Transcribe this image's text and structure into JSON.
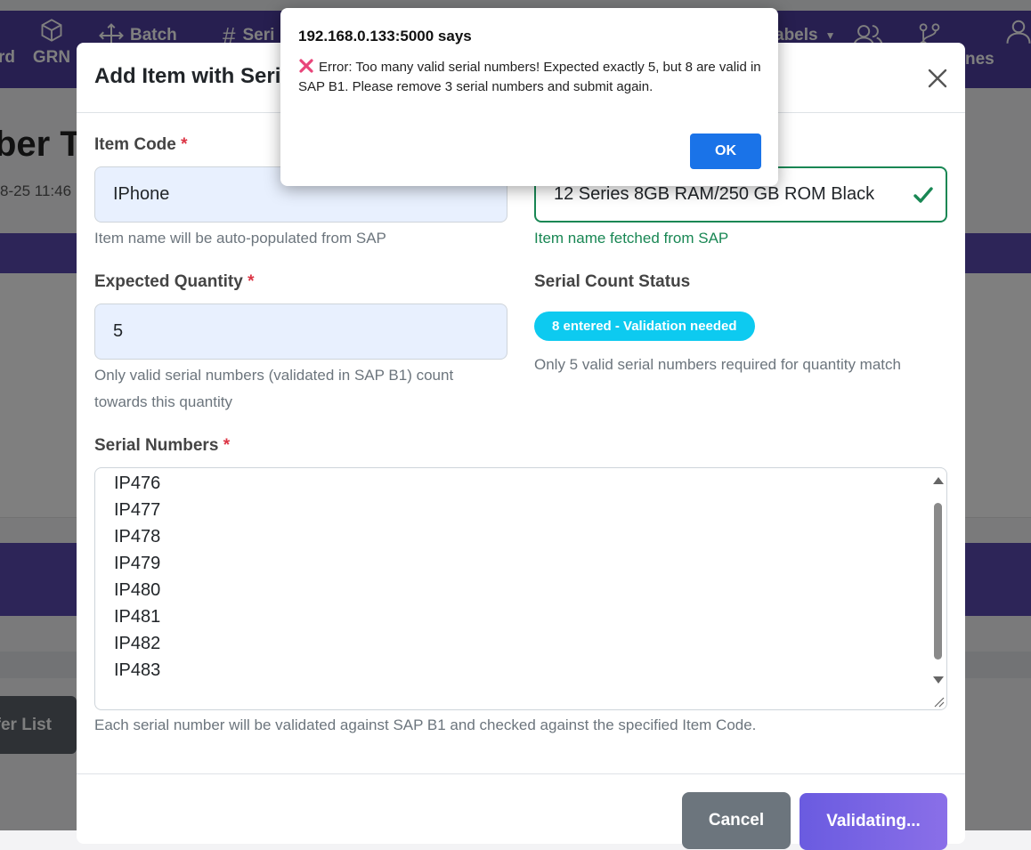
{
  "navbar": {
    "items": [
      {
        "label": "rd",
        "icon": "dashboard-icon"
      },
      {
        "label": "GRN",
        "icon": "box-icon"
      },
      {
        "label": "Batch",
        "icon": "move-icon"
      },
      {
        "label": "Seri",
        "icon": "hash-icon"
      },
      {
        "label": "abels",
        "icon": "label-icon"
      },
      {
        "label": "",
        "icon": "users-icon"
      },
      {
        "label": "",
        "icon": "branch-icon"
      },
      {
        "label": "nes",
        "icon": "user-icon"
      }
    ]
  },
  "background": {
    "page_title": "ber Tr",
    "date_text": "8-25 11:46",
    "back_button": "fer List"
  },
  "modal": {
    "title": "Add Item with Seri",
    "item_code": {
      "label": "Item Code",
      "required_mark": "*",
      "value": "IPhone",
      "help": "Item name will be auto-populated from SAP"
    },
    "item_name": {
      "value": "12 Series 8GB RAM/250 GB ROM Black",
      "help": "Item name fetched from SAP"
    },
    "expected_quantity": {
      "label": "Expected Quantity",
      "required_mark": "*",
      "value": "5",
      "help_line1": "Only valid serial numbers (validated in SAP B1) count",
      "help_line2": "towards this quantity"
    },
    "serial_status": {
      "label": "Serial Count Status",
      "badge": "8 entered - Validation needed",
      "help": "Only 5 valid serial numbers required for quantity match"
    },
    "serial_numbers": {
      "label": "Serial Numbers",
      "required_mark": "*",
      "values": [
        "IP476",
        "IP477",
        "IP478",
        "IP479",
        "IP480",
        "IP481",
        "IP482",
        "IP483"
      ],
      "help": "Each serial number will be validated against SAP B1 and checked against the specified Item Code."
    },
    "buttons": {
      "cancel": "Cancel",
      "validate": "Validating..."
    }
  },
  "alert": {
    "origin": "192.168.0.133:5000 says",
    "message": "Error: Too many valid serial numbers! Expected exactly 5, but 8 are valid in SAP B1. Please remove 3 serial numbers and submit again.",
    "ok_label": "OK"
  },
  "colors": {
    "navbar": "#4f3fa0",
    "badge": "#0dcaf0",
    "success": "#198754",
    "required": "#dc3545",
    "alert_button": "#1a73e8"
  }
}
